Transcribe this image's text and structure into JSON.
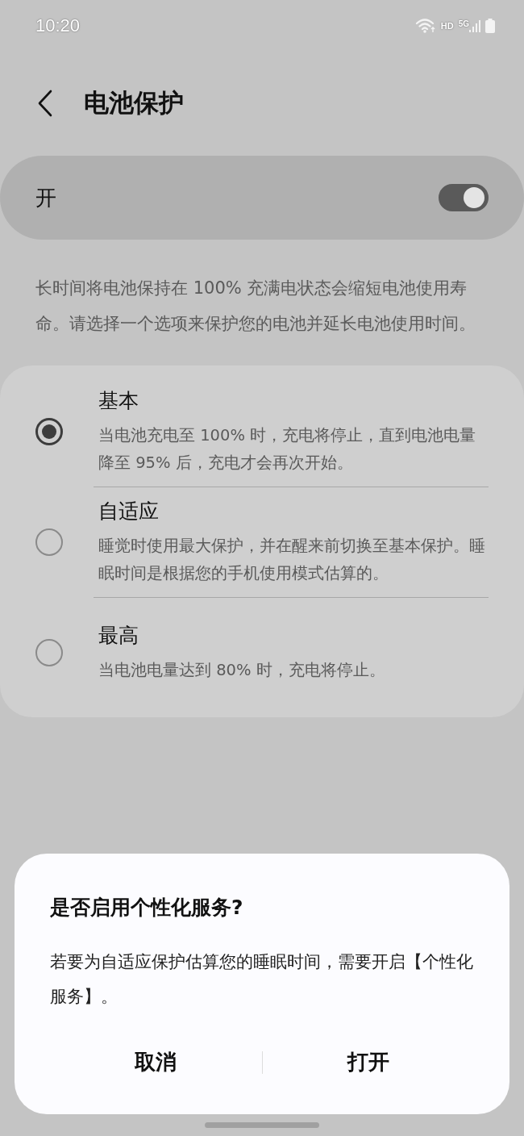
{
  "status_bar": {
    "time": "10:20",
    "network_label": "HD",
    "signal_label": "5G"
  },
  "header": {
    "title": "电池保护"
  },
  "master_switch": {
    "label": "开",
    "on": true
  },
  "description": "长时间将电池保持在 100% 充满电状态会缩短电池使用寿命。请选择一个选项来保护您的电池并延长电池使用时间。",
  "options": [
    {
      "title": "基本",
      "description": "当电池充电至 100% 时，充电将停止，直到电池电量降至 95% 后，充电才会再次开始。",
      "selected": true
    },
    {
      "title": "自适应",
      "description": "睡觉时使用最大保护，并在醒来前切换至基本保护。睡眠时间是根据您的手机使用模式估算的。",
      "selected": false
    },
    {
      "title": "最高",
      "description": "当电池电量达到 80% 时，充电将停止。",
      "selected": false
    }
  ],
  "dialog": {
    "title": "是否启用个性化服务?",
    "message": "若要为自适应保护估算您的睡眠时间，需要开启【个性化服务】。",
    "buttons": [
      "取消",
      "打开"
    ]
  }
}
